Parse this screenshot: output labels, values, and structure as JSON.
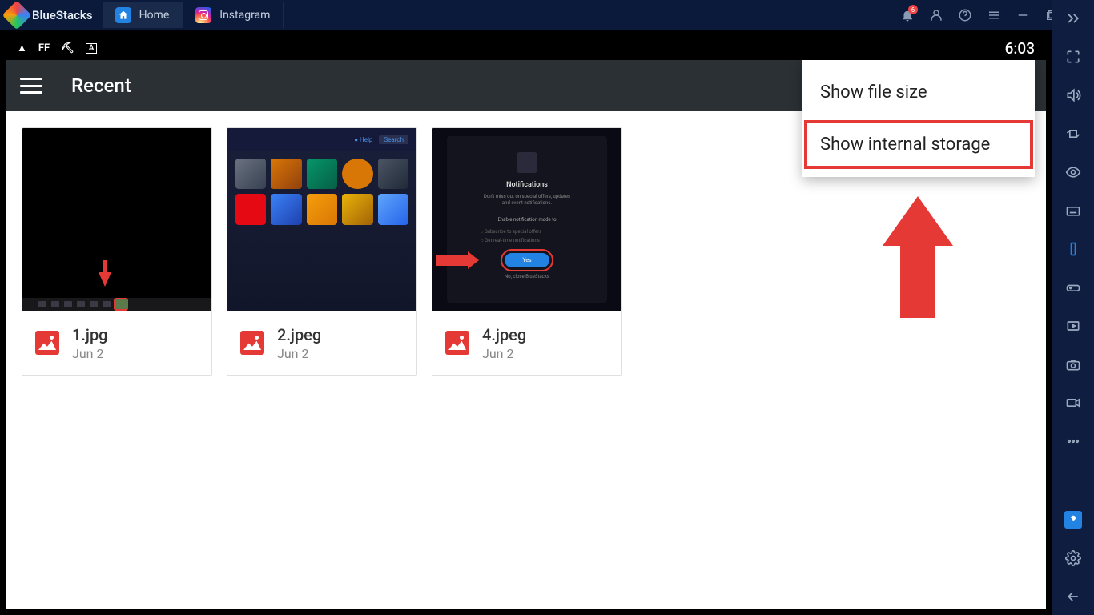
{
  "titlebar": {
    "brand": "BlueStacks",
    "tabs": [
      {
        "label": "Home",
        "icon": "home"
      },
      {
        "label": "Instagram",
        "icon": "instagram"
      }
    ],
    "notification_badge": "6"
  },
  "status_bar": {
    "time": "6:03",
    "icons": [
      "▲",
      "FF",
      "⛏",
      "A"
    ]
  },
  "app_bar": {
    "title": "Recent"
  },
  "files": [
    {
      "name": "1.jpg",
      "date": "Jun 2"
    },
    {
      "name": "2.jpeg",
      "date": "Jun 2"
    },
    {
      "name": "4.jpeg",
      "date": "Jun 2"
    }
  ],
  "dropdown": {
    "items": [
      {
        "label": "Show file size",
        "highlighted": false
      },
      {
        "label": "Show internal storage",
        "highlighted": true
      }
    ]
  }
}
